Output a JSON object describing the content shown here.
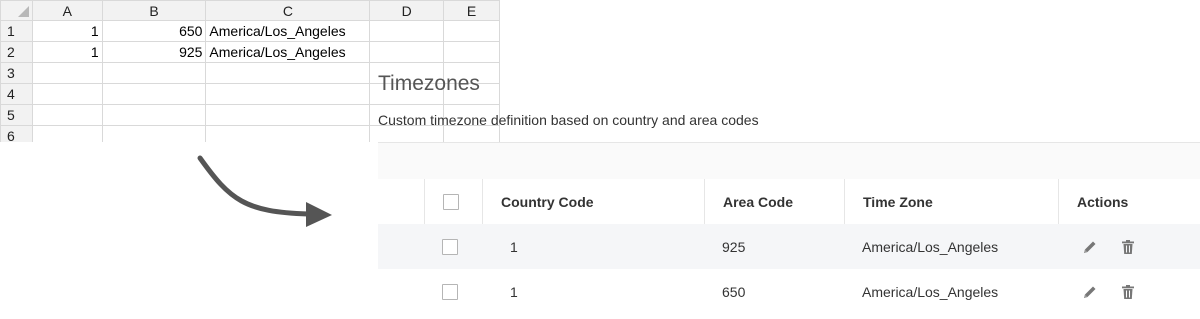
{
  "sheet": {
    "columns": [
      "A",
      "B",
      "C",
      "D",
      "E"
    ],
    "rows": [
      {
        "num": "1",
        "a": "1",
        "b": "650",
        "c": "America/Los_Angeles"
      },
      {
        "num": "2",
        "a": "1",
        "b": "925",
        "c": "America/Los_Angeles"
      },
      {
        "num": "3",
        "a": "",
        "b": "",
        "c": ""
      },
      {
        "num": "4",
        "a": "",
        "b": "",
        "c": ""
      },
      {
        "num": "5",
        "a": "",
        "b": "",
        "c": ""
      },
      {
        "num": "6",
        "a": "",
        "b": "",
        "c": ""
      }
    ]
  },
  "panel": {
    "title": "Timezones",
    "subtitle": "Custom timezone definition based on country and area codes",
    "headers": {
      "country_code": "Country Code",
      "area_code": "Area Code",
      "time_zone": "Time Zone",
      "actions": "Actions"
    },
    "rows": [
      {
        "country_code": "1",
        "area_code": "925",
        "time_zone": "America/Los_Angeles"
      },
      {
        "country_code": "1",
        "area_code": "650",
        "time_zone": "America/Los_Angeles"
      }
    ]
  },
  "icons": {
    "edit": "pencil-icon",
    "delete": "trash-icon",
    "arrow": "curved-arrow"
  },
  "colors": {
    "row_shade": "#f5f6f8",
    "icon": "#777777",
    "arrow": "#555555"
  }
}
